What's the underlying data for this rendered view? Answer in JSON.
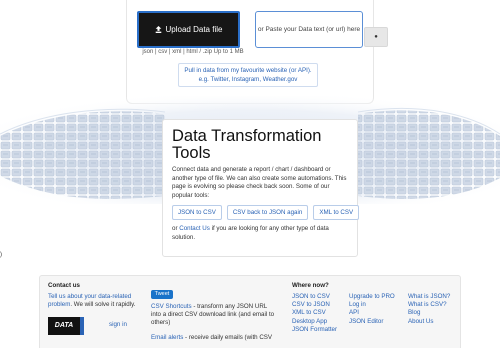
{
  "upload": {
    "button_label": "Upload Data file",
    "paste_placeholder": "or Paste your Data text (or url) here",
    "go_label": "●",
    "formats": "json | csv | xml | html / .zip Up to 1 MB",
    "pull_line1": "Pull in data from my favourite website (or API).",
    "pull_line2": "e.g. Twitter, Instagram, Weather.gov"
  },
  "edge_marker": ")",
  "content": {
    "title_line1": "Data Transformation",
    "title_line2": "Tools",
    "description": "Connect data and generate a report / chart / dashboard or another type of file. We can also create some automations. This page is evolving so please check back soon. Some of our popular tools:",
    "tools": [
      "JSON to CSV",
      "CSV back to JSON again",
      "XML to CSV"
    ],
    "after_prefix": "or ",
    "contact_link": "Contact Us",
    "after_suffix": " if you are looking for any other type of data solution."
  },
  "footer": {
    "contact_title": "Contact us",
    "contact_link": "Tell us about your data-related problem",
    "contact_suffix": ". We will solve it rapidly.",
    "logo_text": "DATA",
    "signin": "sign in",
    "tweet": "Tweet",
    "csv_shortcuts_link": "CSV Shortcuts",
    "csv_shortcuts_text": " - transform any JSON URL into a direct CSV download link (and email to others)",
    "email_alerts_link": "Email alerts",
    "email_alerts_text": " - receive daily emails (with CSV",
    "where_title": "Where now?",
    "col1": [
      "JSON to CSV",
      "CSV to JSON",
      "XML to CSV",
      "Desktop App",
      "JSON Formatter"
    ],
    "col2": [
      "Upgrade to PRO",
      "Log in",
      "API",
      "JSON Editor"
    ],
    "col3": [
      "What is JSON?",
      "What is CSV?",
      "Blog",
      "About Us"
    ]
  }
}
